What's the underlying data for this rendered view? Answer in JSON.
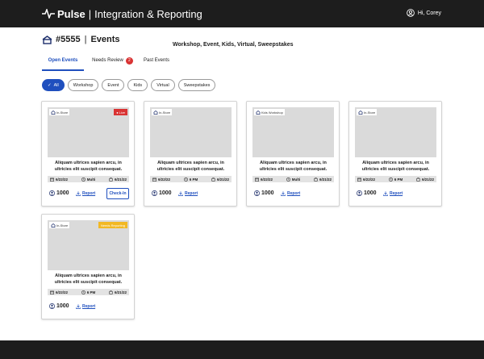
{
  "app": {
    "brand": "Pulse",
    "title": "Integration & Reporting",
    "user_greeting": "Hi, Corey"
  },
  "page": {
    "event_number": "#5555",
    "title": "Events",
    "subtitle": "Workshop, Event, Kids, Virtual, Sweepstakes"
  },
  "tabs": [
    {
      "label": "Open Events",
      "active": true
    },
    {
      "label": "Needs Review",
      "badge": "2"
    },
    {
      "label": "Past Events"
    }
  ],
  "filters": [
    {
      "label": "All",
      "active": true
    },
    {
      "label": "Workshop"
    },
    {
      "label": "Event"
    },
    {
      "label": "Kids"
    },
    {
      "label": "Virtual"
    },
    {
      "label": "Sweepstakes"
    }
  ],
  "cards": [
    {
      "type": "In-Store",
      "status": "Live",
      "status_color": "#d93333",
      "description": "Aliquam ultrices sapien arcu, in ultricies elit suscipit consequat.",
      "start_date": "6/22/22",
      "time": "Multi",
      "end_date": "6/21/22",
      "count": "1000",
      "report_label": "Report",
      "checkin_label": "Check-In"
    },
    {
      "type": "In-Store",
      "description": "Aliquam ultrices sapien arcu, in ultricies elit suscipit consequat.",
      "start_date": "6/22/22",
      "time": "6 PM",
      "end_date": "6/21/22",
      "count": "1000",
      "report_label": "Report"
    },
    {
      "type": "Kids Workshop",
      "description": "Aliquam ultrices sapien arcu, in ultricies elit suscipit consequat.",
      "start_date": "6/22/22",
      "time": "Multi",
      "end_date": "6/21/22",
      "count": "1000",
      "report_label": "Report"
    },
    {
      "type": "In-Store",
      "description": "Aliquam ultrices sapien arcu, in ultricies elit suscipit consequat.",
      "start_date": "6/22/22",
      "time": "6 PM",
      "end_date": "6/21/22",
      "count": "1000",
      "report_label": "Report"
    },
    {
      "type": "In-Store",
      "status": "Needs Reporting",
      "status_color": "#f2b824",
      "description": "Aliquam ultrices sapien arcu, in ultricies elit suscipit consequat.",
      "start_date": "6/22/22",
      "time": "6 PM",
      "end_date": "6/21/22",
      "count": "1000",
      "report_label": "Report"
    }
  ],
  "colors": {
    "accent": "#1f4fbe",
    "header_bg": "#1d1d1d",
    "live": "#d93333",
    "needs_reporting": "#f2b824"
  },
  "icons": {
    "brand": "pulse-wave-icon",
    "user": "user-circle-icon",
    "store": "store-icon",
    "calendar": "calendar-icon",
    "clock": "clock-icon",
    "end": "calendar-end-icon",
    "attendees": "person-icon",
    "report": "download-icon"
  }
}
